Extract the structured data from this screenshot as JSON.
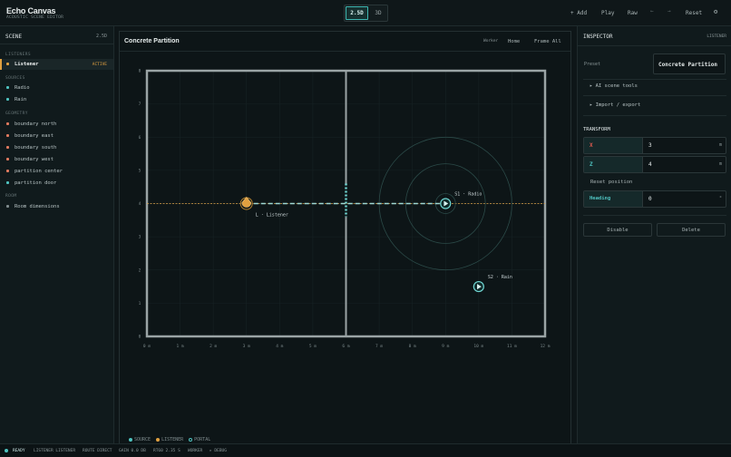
{
  "app": {
    "title": "Echo Canvas",
    "subtitle": "ACOUSTIC SCENE EDITOR"
  },
  "toolbar": {
    "view_modes": [
      "2.5D",
      "3D"
    ],
    "active_view": "2.5D",
    "add_label": "+ Add",
    "play_label": "Play",
    "raw_label": "Raw",
    "undo_glyph": "←",
    "redo_glyph": "→",
    "reset_label": "Reset",
    "settings_glyph": "⚙"
  },
  "scene_panel": {
    "title": "SCENE",
    "mode": "2.5D",
    "groups": [
      {
        "label": "LISTENERS",
        "items": [
          {
            "label": "Listener",
            "color": "#e0a040",
            "badge": "ACTIVE",
            "selected": true
          }
        ]
      },
      {
        "label": "SOURCES",
        "items": [
          {
            "label": "Radio",
            "color": "#4fc3c0"
          },
          {
            "label": "Rain",
            "color": "#4fc3c0"
          }
        ]
      },
      {
        "label": "GEOMETRY",
        "items": [
          {
            "label": "boundary north",
            "color": "#e07a5f"
          },
          {
            "label": "boundary east",
            "color": "#e07a5f"
          },
          {
            "label": "boundary south",
            "color": "#e07a5f"
          },
          {
            "label": "boundary west",
            "color": "#e07a5f"
          },
          {
            "label": "partition center",
            "color": "#e07a5f"
          },
          {
            "label": "partition door",
            "color": "#4fc3c0"
          }
        ]
      },
      {
        "label": "ROOM",
        "items": [
          {
            "label": "Room dimensions",
            "color": "#7f8b8d"
          }
        ]
      }
    ]
  },
  "viewport": {
    "title": "Concrete Partition",
    "worker_label": "Worker",
    "home_label": "Home",
    "frame_all_label": "Frame All",
    "x_ticks": [
      "0 m",
      "1 m",
      "2 m",
      "3 m",
      "4 m",
      "5 m",
      "6 m",
      "7 m",
      "8 m",
      "9 m",
      "10 m",
      "11 m",
      "12 m"
    ],
    "y_ticks": [
      "0",
      "1",
      "2",
      "3",
      "4",
      "5",
      "6",
      "7",
      "8"
    ],
    "room": {
      "width_m": 12,
      "depth_m": 8
    },
    "partition_x_m": 6,
    "door": {
      "x_m": 6,
      "z_from_m": 3.6,
      "z_to_m": 4.6
    },
    "listener": {
      "label": "L · Listener",
      "x_m": 3,
      "z_m": 4
    },
    "sources": [
      {
        "label": "S1 · Radio",
        "x_m": 9,
        "z_m": 4,
        "rings_m": [
          0.3,
          1.2,
          2.0
        ]
      },
      {
        "label": "S2 · Rain",
        "x_m": 10,
        "z_m": 1.5
      }
    ],
    "legend": [
      {
        "label": "SOURCE",
        "color": "#4fc3c0",
        "style": "filled"
      },
      {
        "label": "LISTENER",
        "color": "#e0a040",
        "style": "filled"
      },
      {
        "label": "PORTAL",
        "color": "#4fc3c0",
        "style": "outline"
      }
    ]
  },
  "inspector": {
    "title": "INSPECTOR",
    "target": "LISTENER",
    "preset_label": "Preset",
    "preset_value": "Concrete Partition",
    "sections": [
      "▸ AI scene tools",
      "▸ Import / export"
    ],
    "transform_title": "TRANSFORM",
    "fields": [
      {
        "label": "X",
        "value": "3",
        "unit": "m",
        "color": "#e05a4f"
      },
      {
        "label": "Z",
        "value": "4",
        "unit": "m",
        "color": "#4fc3c0"
      }
    ],
    "reset_position_label": "Reset position",
    "heading": {
      "label": "Heading",
      "value": "0",
      "unit": "°",
      "color": "#4fc3c0"
    },
    "disable_label": "Disable",
    "delete_label": "Delete"
  },
  "status": {
    "ready": "READY",
    "listener": "LISTENER LISTENER",
    "route": "ROUTE DIRECT",
    "gain": "GAIN 0.0 DB",
    "rt60": "RT60 2.35 S",
    "worker": "WORKER",
    "debug": "▸ DEBUG"
  }
}
